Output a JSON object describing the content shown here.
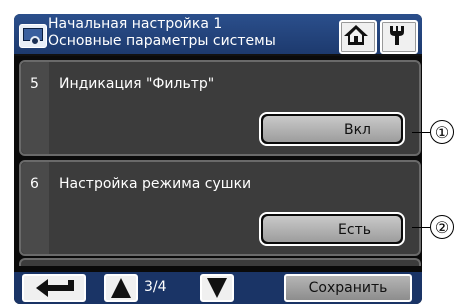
{
  "header": {
    "title_line1": "Начальная настройка 1",
    "title_line2": "Основные параметры системы",
    "settings_icon": "settings-screen-icon",
    "home_icon": "home-icon",
    "tool_icon": "wrench-icon"
  },
  "items": [
    {
      "number": "5",
      "label": "Индикация \"Фильтр\"",
      "value": "Вкл"
    },
    {
      "number": "6",
      "label": "Настройка режима сушки",
      "value": "Есть"
    }
  ],
  "footer": {
    "back_icon": "return-arrow-icon",
    "up_icon": "triangle-up-icon",
    "down_icon": "triangle-down-icon",
    "page_indicator": "3/4",
    "save_label": "Сохранить"
  },
  "callouts": [
    "①",
    "②"
  ],
  "colors": {
    "header_bg": "#1d3a6e",
    "item_bg": "#3c3c3c",
    "footer_bg": "#1a3466"
  }
}
